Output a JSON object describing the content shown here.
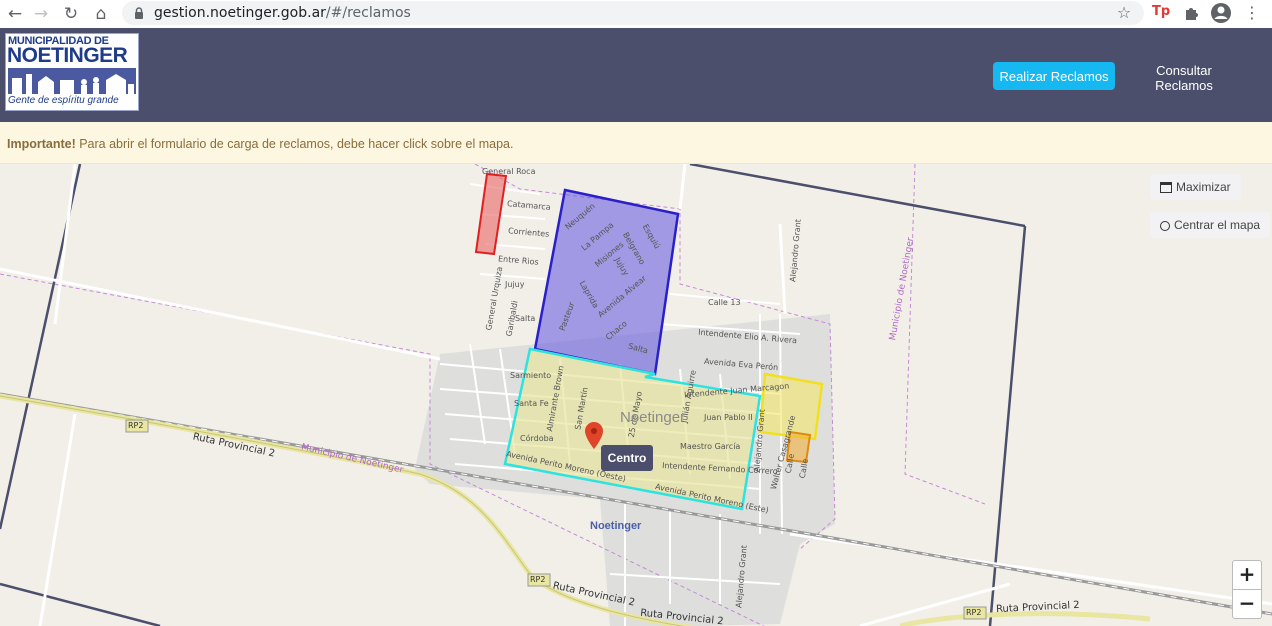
{
  "browser": {
    "url_host": "gestion.noetinger.gob.ar",
    "url_path": "/#/reclamos",
    "extension_label": "Tp"
  },
  "header": {
    "logo": {
      "line1": "MUNICIPALIDAD DE",
      "line2": "NOETINGER",
      "tagline": "Gente de espíritu grande"
    },
    "nav": {
      "primary_label": "Realizar Reclamos",
      "secondary_label": "Consultar Reclamos"
    }
  },
  "alert": {
    "strong": "Importante!",
    "text": " Para abrir el formulario de carga de reclamos, debe hacer click sobre el mapa."
  },
  "map": {
    "controls": {
      "maximize_label": "Maximizar",
      "center_label": "Centrar el mapa",
      "zoom_in": "+",
      "zoom_out": "−"
    },
    "marker_tooltip": "Centro",
    "town_name": "Noetinger",
    "town_label_small": "Noetinger",
    "road_shield": "RP2",
    "road_name": "Ruta Provincial 2",
    "municipality_label": "Municipio de Noetinger",
    "streets": {
      "general_roca": "General Roca",
      "catamarca": "Catamarca",
      "corrientes": "Corrientes",
      "entre_rios": "Entre Rios",
      "jujuy": "Jujuy",
      "salta_w": "Salta",
      "sarmiento": "Sarmiento",
      "santa_fe": "Santa Fe",
      "cordoba": "Córdoba",
      "general_urquiza": "General Urquiza",
      "garibaldi": "Garibaldi",
      "neuquen": "Neuquén",
      "la_pampa": "La Pampa",
      "misiones": "Misiones",
      "esquiu": "Esquiú",
      "belgrano": "Belgrano",
      "jujuy2": "Jujuy",
      "laprida": "Laprida",
      "avenida_alvear": "Avenida Alvear",
      "pasteur": "Pasteur",
      "chaco": "Chaco",
      "salta_e": "Salta",
      "calle13": "Calle 13",
      "intendente_rivera": "Intendente Elio A. Rivera",
      "eva_peron": "Avenida Eva Perón",
      "alejandro_grant_n": "Alejandro Grant",
      "alejandro_grant_c": "Alejandro Grant",
      "alejandro_grant_s": "Alejandro Grant",
      "almirante_brown": "Almirante Brown",
      "san_martin": "San Martín",
      "mayo": "25 de Mayo",
      "julian_aguirre": "Julián Aguirre",
      "marcagon": "Intendente Juan Marcagon",
      "juan_pablo": "Juan Pablo II",
      "maestro_garcia": "Maestro García",
      "fernando_correro": "Intendente Fernando Correro",
      "walter_casagrande": "Walter Casagrande",
      "calle_a": "Calle",
      "calle_b": "Calle",
      "perito_oeste": "Avenida Perito Moreno (Oeste)",
      "perito_este": "Avenida Perito Moreno (Este)"
    }
  }
}
